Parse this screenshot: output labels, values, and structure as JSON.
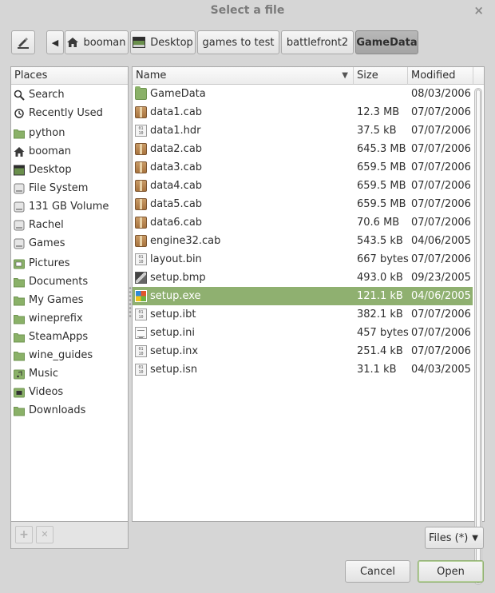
{
  "window": {
    "title": "Select a file",
    "close_glyph": "×"
  },
  "toolbar": {
    "edit_icon": "pencil-icon",
    "back_glyph": "◀",
    "breadcrumbs": [
      {
        "label": "booman",
        "icon": "home-icon"
      },
      {
        "label": "Desktop",
        "icon": "desktop-icon"
      },
      {
        "label": "games to test"
      },
      {
        "label": "battlefront2"
      },
      {
        "label": "GameData",
        "active": true
      }
    ]
  },
  "places": {
    "header": "Places",
    "items": [
      {
        "label": "Search",
        "icon": "search-icon"
      },
      {
        "label": "Recently Used",
        "icon": "recent-icon"
      },
      {
        "label": "python",
        "icon": "folder-icon"
      },
      {
        "label": "booman",
        "icon": "home-icon"
      },
      {
        "label": "Desktop",
        "icon": "desktop-icon"
      },
      {
        "label": "File System",
        "icon": "drive-icon"
      },
      {
        "label": "131 GB Volume",
        "icon": "drive-icon"
      },
      {
        "label": "Rachel",
        "icon": "drive-icon"
      },
      {
        "label": "Games",
        "icon": "drive-icon"
      },
      {
        "label": "Pictures",
        "icon": "pictures-folder-icon"
      },
      {
        "label": "Documents",
        "icon": "folder-icon"
      },
      {
        "label": "My Games",
        "icon": "folder-icon"
      },
      {
        "label": "wineprefix",
        "icon": "folder-icon"
      },
      {
        "label": "SteamApps",
        "icon": "folder-icon"
      },
      {
        "label": "wine_guides",
        "icon": "folder-icon"
      },
      {
        "label": "Music",
        "icon": "music-folder-icon"
      },
      {
        "label": "Videos",
        "icon": "videos-folder-icon"
      },
      {
        "label": "Downloads",
        "icon": "folder-icon"
      }
    ],
    "add_glyph": "+",
    "remove_glyph": "✕"
  },
  "files": {
    "columns": {
      "name": "Name",
      "size": "Size",
      "modified": "Modified",
      "sort_glyph": "▼"
    },
    "rows": [
      {
        "name": "GameData",
        "size": "",
        "modified": "08/03/2006",
        "type": "folder"
      },
      {
        "name": "data1.cab",
        "size": "12.3 MB",
        "modified": "07/07/2006",
        "type": "cab"
      },
      {
        "name": "data1.hdr",
        "size": "37.5 kB",
        "modified": "07/07/2006",
        "type": "bin"
      },
      {
        "name": "data2.cab",
        "size": "645.3 MB",
        "modified": "07/07/2006",
        "type": "cab"
      },
      {
        "name": "data3.cab",
        "size": "659.5 MB",
        "modified": "07/07/2006",
        "type": "cab"
      },
      {
        "name": "data4.cab",
        "size": "659.5 MB",
        "modified": "07/07/2006",
        "type": "cab"
      },
      {
        "name": "data5.cab",
        "size": "659.5 MB",
        "modified": "07/07/2006",
        "type": "cab"
      },
      {
        "name": "data6.cab",
        "size": "70.6 MB",
        "modified": "07/07/2006",
        "type": "cab"
      },
      {
        "name": "engine32.cab",
        "size": "543.5 kB",
        "modified": "04/06/2005",
        "type": "cab"
      },
      {
        "name": "layout.bin",
        "size": "667 bytes",
        "modified": "07/07/2006",
        "type": "bin"
      },
      {
        "name": "setup.bmp",
        "size": "493.0 kB",
        "modified": "09/23/2005",
        "type": "bmp"
      },
      {
        "name": "setup.exe",
        "size": "121.1 kB",
        "modified": "04/06/2005",
        "type": "exe",
        "selected": true
      },
      {
        "name": "setup.ibt",
        "size": "382.1 kB",
        "modified": "07/07/2006",
        "type": "bin"
      },
      {
        "name": "setup.ini",
        "size": "457 bytes",
        "modified": "07/07/2006",
        "type": "txt"
      },
      {
        "name": "setup.inx",
        "size": "251.4 kB",
        "modified": "07/07/2006",
        "type": "bin"
      },
      {
        "name": "setup.isn",
        "size": "31.1 kB",
        "modified": "04/03/2005",
        "type": "bin"
      }
    ]
  },
  "filter": {
    "value": "Files (*)",
    "glyph": "▼"
  },
  "actions": {
    "cancel": "Cancel",
    "open": "Open"
  },
  "colors": {
    "selection": "#8fb070",
    "folder": "#8ab168"
  }
}
